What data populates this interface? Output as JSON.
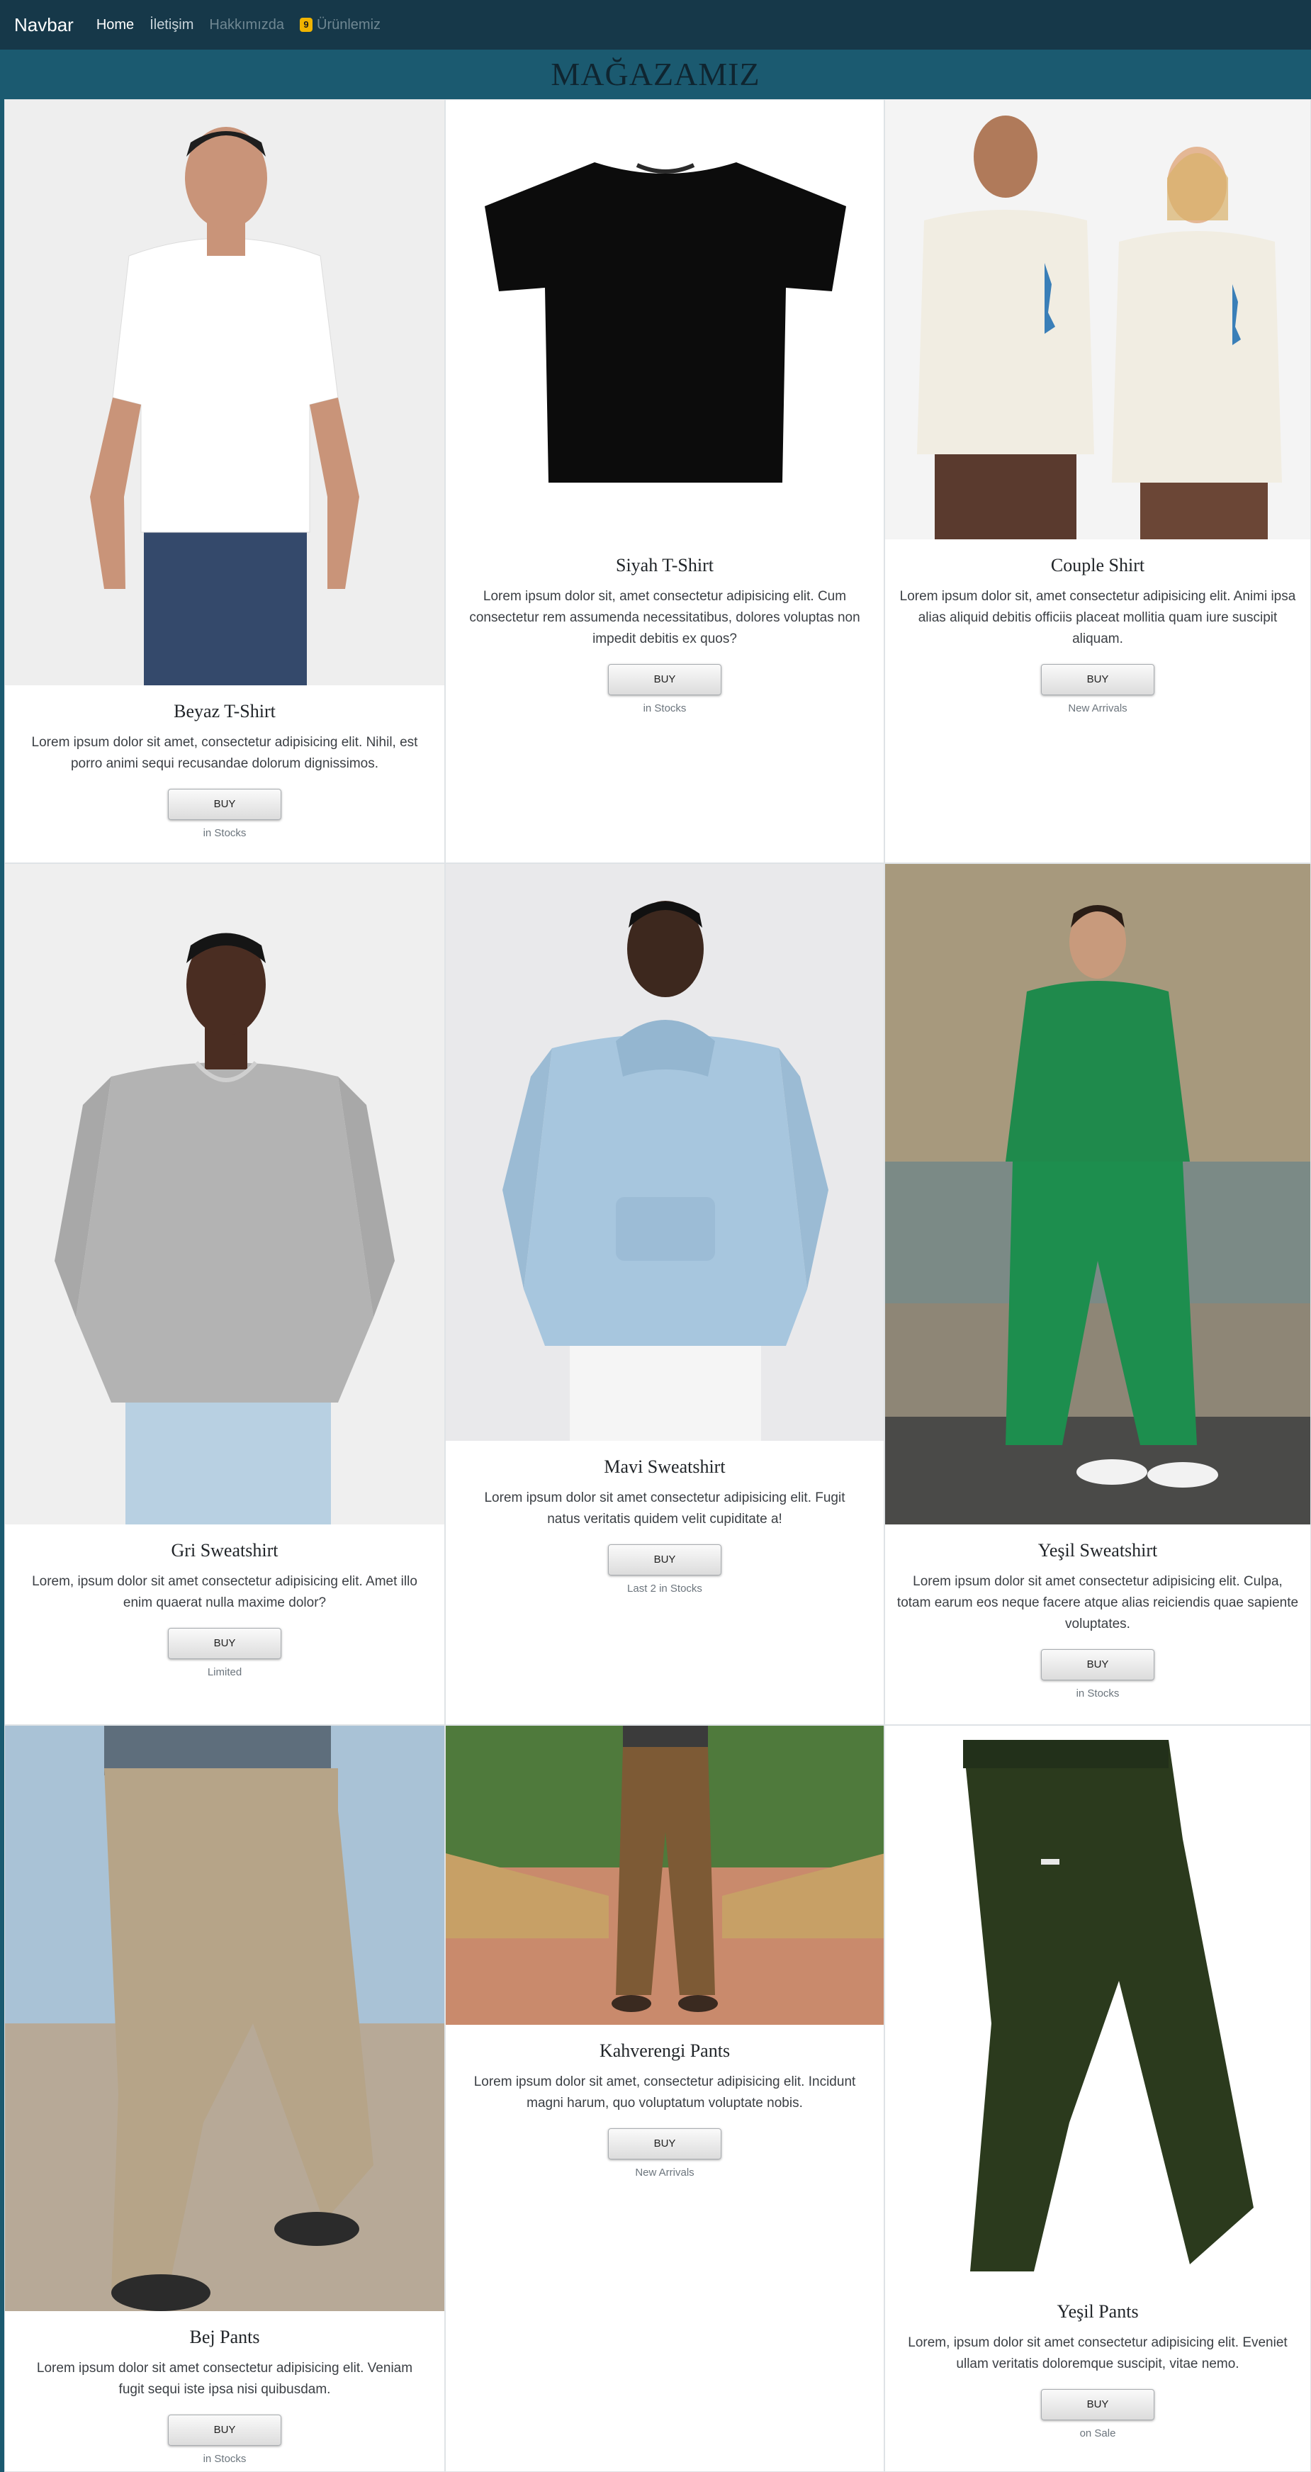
{
  "navbar": {
    "brand": "Navbar",
    "links": [
      {
        "label": "Home"
      },
      {
        "label": "İletişim"
      },
      {
        "label": "Hakkımızda"
      },
      {
        "label": "Ürünlemiz",
        "badge": "9"
      }
    ]
  },
  "page_title": "MAĞAZAMIZ",
  "colors": {
    "navbar_bg": "#163849",
    "page_bg": "#1b5a70",
    "badge": "#f0b400"
  },
  "products": [
    {
      "title": "Beyaz T-Shirt",
      "text": "Lorem ipsum dolor sit amet, consectetur adipisicing elit. Nihil, est porro animi sequi recusandae dolorum dignissimos.",
      "button": "BUY",
      "stock": "in Stocks",
      "image": "man-in-white-tshirt"
    },
    {
      "title": "Siyah T-Shirt",
      "text": "Lorem ipsum dolor sit, amet consectetur adipisicing elit. Cum consectetur rem assumenda necessitatibus, dolores voluptas non impedit debitis ex quos?",
      "button": "BUY",
      "stock": "in Stocks",
      "image": "black-tshirt"
    },
    {
      "title": "Couple Shirt",
      "text": "Lorem ipsum dolor sit, amet consectetur adipisicing elit. Animi ipsa alias aliquid debitis officiis placeat mollitia quam iure suscipit aliquam.",
      "button": "BUY",
      "stock": "New Arrivals",
      "image": "couple-in-shirts"
    },
    {
      "title": "Gri Sweatshirt",
      "text": "Lorem, ipsum dolor sit amet consectetur adipisicing elit. Amet illo enim quaerat nulla maxime dolor?",
      "button": "BUY",
      "stock": "Limited",
      "image": "man-in-grey-sweatshirt"
    },
    {
      "title": "Mavi Sweatshirt",
      "text": "Lorem ipsum dolor sit amet consectetur adipisicing elit. Fugit natus veritatis quidem velit cupiditate a!",
      "button": "BUY",
      "stock": "Last 2 in Stocks",
      "image": "man-in-blue-hoodie"
    },
    {
      "title": "Yeşil Sweatshirt",
      "text": "Lorem ipsum dolor sit amet consectetur adipisicing elit. Culpa, totam earum eos neque facere atque alias reiciendis quae sapiente voluptates.",
      "button": "BUY",
      "stock": "in Stocks",
      "image": "man-in-green-tracksuit"
    },
    {
      "title": "Bej Pants",
      "text": "Lorem ipsum dolor sit amet consectetur adipisicing elit. Veniam fugit sequi iste ipsa nisi quibusdam.",
      "button": "BUY",
      "stock": "in Stocks",
      "image": "beige-cargo-pants"
    },
    {
      "title": "Kahverengi Pants",
      "text": "Lorem ipsum dolor sit amet, consectetur adipisicing elit. Incidunt magni harum, quo voluptatum voluptate nobis.",
      "button": "BUY",
      "stock": "New Arrivals",
      "image": "brown-cargo-pants"
    },
    {
      "title": "Yeşil Pants",
      "text": "Lorem, ipsum dolor sit amet consectetur adipisicing elit. Eveniet ullam veritatis doloremque suscipit, vitae nemo.",
      "button": "BUY",
      "stock": "on Sale",
      "image": "green-pants"
    }
  ]
}
